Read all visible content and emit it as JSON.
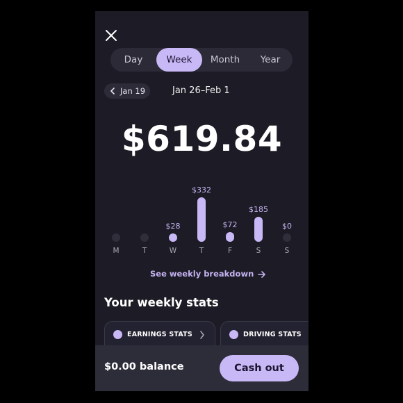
{
  "period_tabs": {
    "items": [
      "Day",
      "Week",
      "Month",
      "Year"
    ],
    "selected": "Week"
  },
  "nav": {
    "prev_label": "Jan 19",
    "current_range": "Jan 26–Feb 1"
  },
  "earnings": {
    "total": "$619.84"
  },
  "chart_data": {
    "type": "bar",
    "categories": [
      "M",
      "T",
      "W",
      "T",
      "F",
      "S",
      "S"
    ],
    "values": [
      0,
      0,
      28,
      332,
      72,
      185,
      0
    ],
    "data_labels": [
      "",
      "",
      "$28",
      "$332",
      "$72",
      "$185",
      "$0"
    ],
    "ylim": [
      0,
      332
    ]
  },
  "breakdown_link": "See weekly breakdown",
  "stats": {
    "title": "Your weekly stats",
    "cards": [
      "EARNINGS STATS",
      "DRIVING STATS"
    ]
  },
  "footer": {
    "balance": "$0.00 balance",
    "cashout_label": "Cash out"
  },
  "colors": {
    "accent": "#c9b8f6",
    "background": "#1d1c26"
  },
  "icons": {
    "close": "close-icon",
    "prev": "chevron-left-icon",
    "arrow": "arrow-right-icon",
    "earnings_card": "earnings-icon",
    "driving_card": "car-icon",
    "card_chevron": "chevron-right-icon"
  }
}
